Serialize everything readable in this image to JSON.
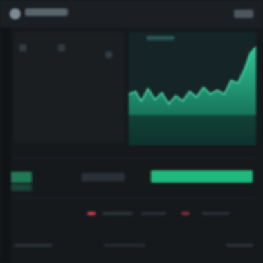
{
  "colors": {
    "background": "#16191c",
    "accent": "#2fcf98",
    "accent_dark": "#0f5648",
    "negative": "#c43b4b"
  },
  "header": {
    "logo_icon": "logo-icon",
    "menu_icon": "menu-icon"
  },
  "chart": {
    "icon": "area-chart"
  },
  "progress": {
    "fill_fraction": 0.97
  }
}
